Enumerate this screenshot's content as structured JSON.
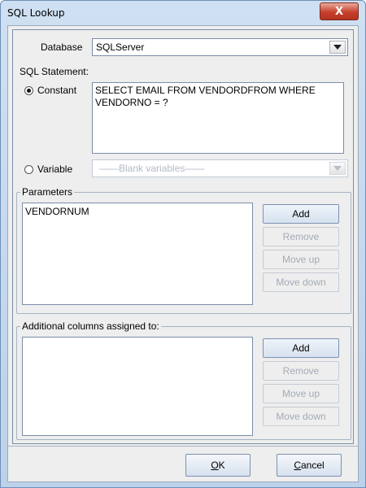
{
  "window": {
    "title": "SQL Lookup",
    "close_glyph": "X"
  },
  "database": {
    "label": "Database",
    "value": "SQLServer"
  },
  "sql_statement": {
    "label": "SQL Statement:",
    "constant_label": "Constant",
    "constant_selected": true,
    "constant_text": "SELECT EMAIL FROM VENDORDFROM WHERE VENDORNO = ?",
    "variable_label": "Variable",
    "variable_placeholder": "——Blank variables——"
  },
  "parameters": {
    "title": "Parameters",
    "items": [
      "VENDORNUM"
    ],
    "buttons": {
      "add": "Add",
      "remove": "Remove",
      "move_up": "Move up",
      "move_down": "Move down"
    }
  },
  "additional_columns": {
    "title": "Additional columns assigned to:",
    "items": [],
    "buttons": {
      "add": "Add",
      "remove": "Remove",
      "move_up": "Move up",
      "move_down": "Move down"
    }
  },
  "footer": {
    "ok_mnemonic": "O",
    "ok_rest": "K",
    "cancel_mnemonic": "C",
    "cancel_rest": "ancel"
  },
  "colors": {
    "title_gradient_top": "#cfe0f2",
    "close_button": "#c7402c",
    "panel_background": "#eeeeee",
    "disabled_text": "#a3abb6"
  }
}
